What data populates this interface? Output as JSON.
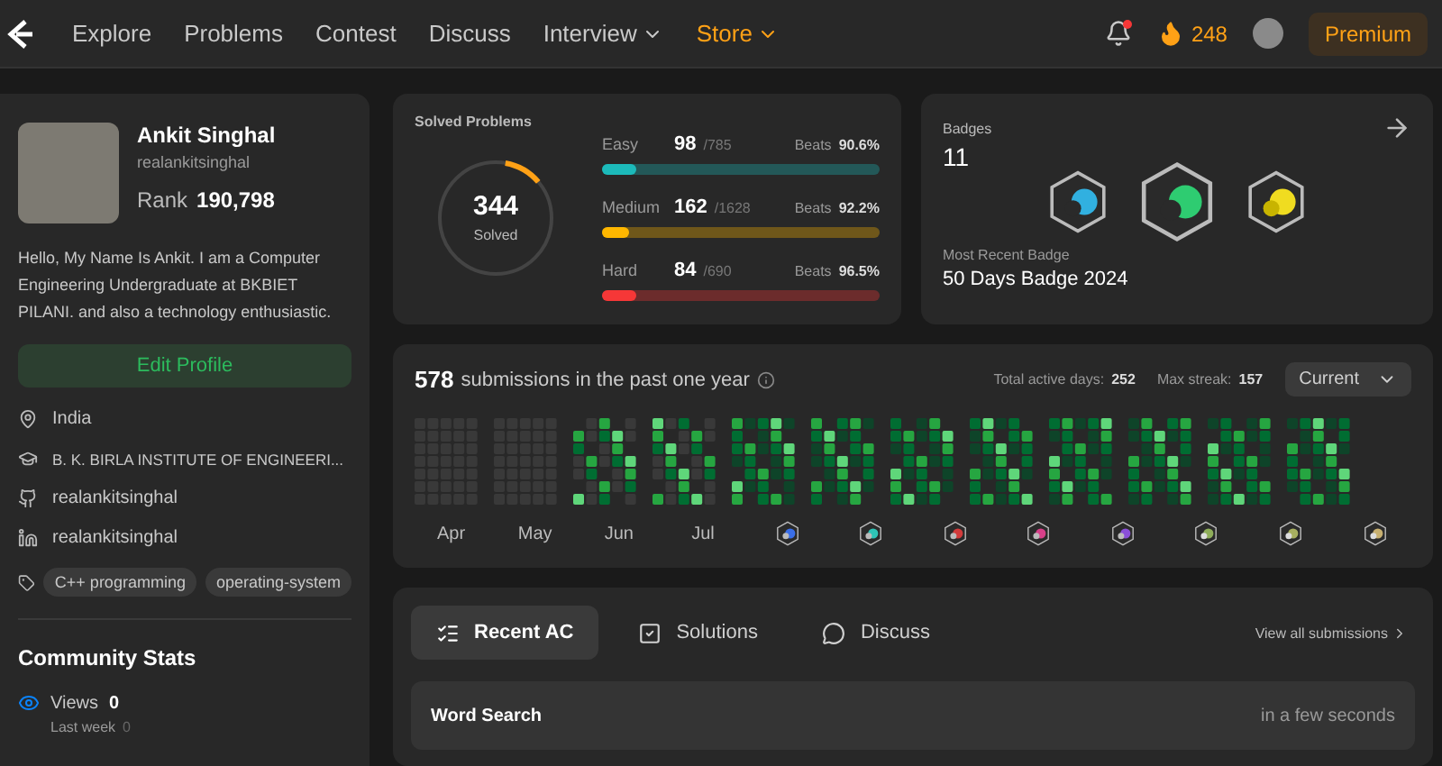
{
  "nav": {
    "items": [
      {
        "label": "Explore",
        "dropdown": false,
        "accent": false
      },
      {
        "label": "Problems",
        "dropdown": false,
        "accent": false
      },
      {
        "label": "Contest",
        "dropdown": false,
        "accent": false
      },
      {
        "label": "Discuss",
        "dropdown": false,
        "accent": false
      },
      {
        "label": "Interview",
        "dropdown": true,
        "accent": false
      },
      {
        "label": "Store",
        "dropdown": true,
        "accent": true
      }
    ],
    "notification": true,
    "streak": "248",
    "premium": "Premium"
  },
  "profile": {
    "name": "Ankit Singhal",
    "username": "realankitsinghal",
    "rank_label": "Rank",
    "rank": "190,798",
    "bio": "Hello, My Name Is Ankit. I am a Computer Engineering Undergraduate at BKBIET PILANI. and also a technology enthusiastic.",
    "edit_button": "Edit Profile",
    "details": [
      {
        "kind": "location",
        "text": "India"
      },
      {
        "kind": "school",
        "text": "B. K. BIRLA INSTITUTE OF ENGINEERI..."
      },
      {
        "kind": "github",
        "text": "realankitsinghal"
      },
      {
        "kind": "linkedin",
        "text": "realankitsinghal"
      }
    ],
    "skills": [
      "C++ programming",
      "operating-system"
    ],
    "community": {
      "title": "Community Stats",
      "views_label": "Views",
      "views": "0",
      "sub_label": "Last week",
      "sub_value": "0"
    }
  },
  "solved": {
    "title": "Solved Problems",
    "total": "344",
    "total_label": "Solved",
    "level": 0.11,
    "rows": [
      {
        "label": "Easy",
        "count": "98",
        "total": "/785",
        "beats_label": "Beats",
        "beats": "90.6%",
        "level": 0.125,
        "color": "#1cbaba"
      },
      {
        "label": "Medium",
        "count": "162",
        "total": "/1628",
        "beats_label": "Beats",
        "beats": "92.2%",
        "level": 0.1,
        "color": "#ffb700"
      },
      {
        "label": "Hard",
        "count": "84",
        "total": "/690",
        "beats_label": "Beats",
        "beats": "96.5%",
        "level": 0.122,
        "color": "#f63737"
      }
    ]
  },
  "badges": {
    "title": "Badges",
    "count": "11",
    "recent_label": "Most Recent Badge",
    "recent": "50 Days Badge 2024"
  },
  "activity": {
    "count": "578",
    "text": "submissions in the past one year",
    "active_label": "Total active days:",
    "active": "252",
    "streak_label": "Max streak:",
    "streak": "157",
    "period": "Current",
    "months": [
      "Apr",
      "May",
      "Jun",
      "Jul"
    ]
  },
  "recent": {
    "tabs": [
      {
        "label": "Recent AC",
        "selected": true
      },
      {
        "label": "Solutions",
        "selected": false
      },
      {
        "label": "Discuss",
        "selected": false
      }
    ],
    "view_all": "View all submissions",
    "items": [
      {
        "title": "Word Search",
        "time": "in a few seconds"
      }
    ]
  }
}
